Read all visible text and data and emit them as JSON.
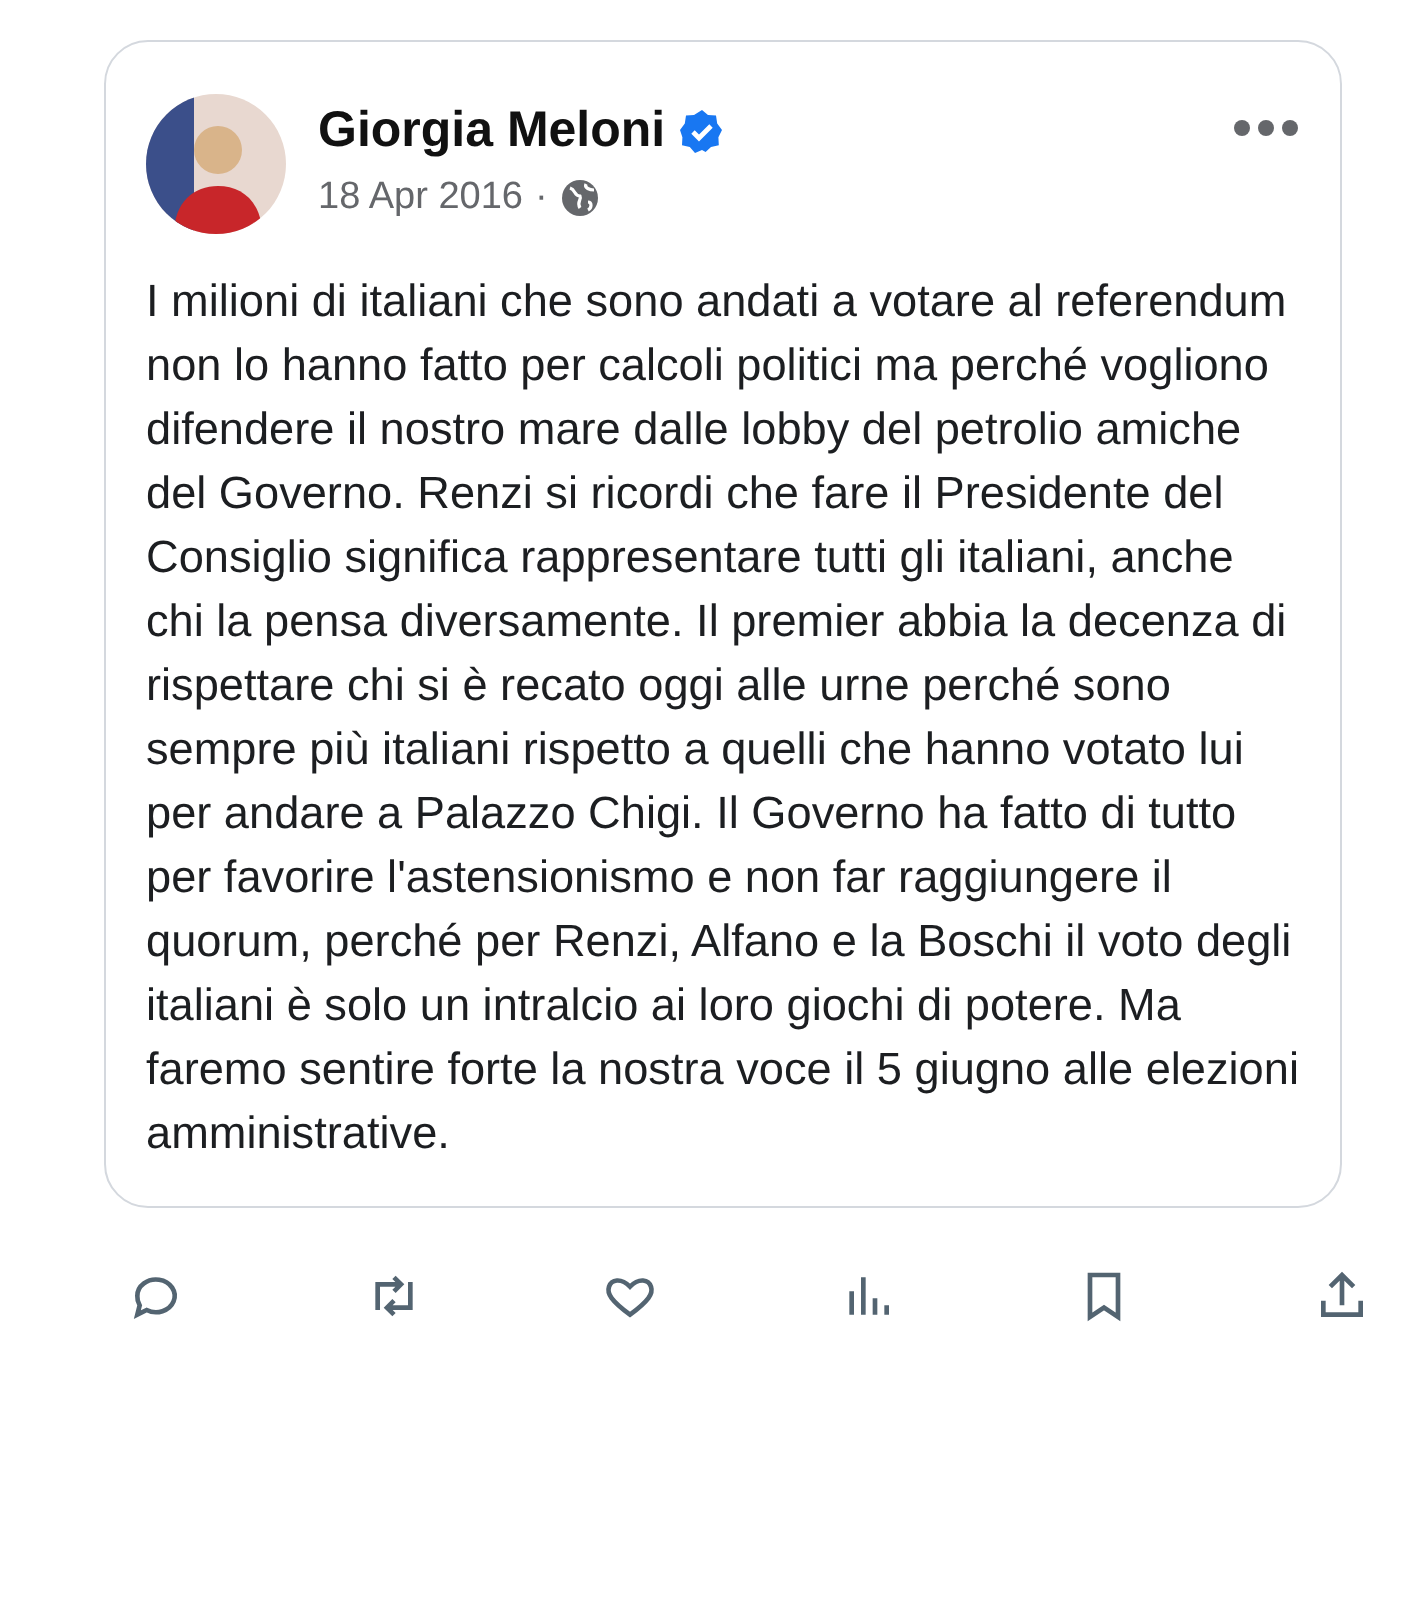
{
  "post": {
    "author": "Giorgia Meloni",
    "verified": true,
    "date": "18 Apr 2016",
    "separator": "·",
    "text": "I milioni di italiani che sono andati a votare al referendum non lo hanno fatto per calcoli politici ma perché vogliono difendere il nostro mare dalle lobby del petrolio amiche del Governo. Renzi si ricordi che fare il Presidente del Consiglio significa rappresentare tutti gli italiani, anche chi la pensa diversamente. Il premier abbia la decenza di rispettare chi si è recato oggi alle urne perché sono sempre più italiani rispetto a quelli che hanno votato lui per andare a Palazzo Chigi. Il Governo ha fatto di tutto per favorire l'astensionismo e non far raggiungere il quorum, perché per Renzi, Alfano e la Boschi il voto degli italiani è solo un intralcio ai loro giochi di potere. Ma faremo sentire forte la nostra voce il 5 giugno alle elezioni amministrative."
  },
  "actions": [
    {
      "kind": "reply"
    },
    {
      "kind": "repost"
    },
    {
      "kind": "like"
    },
    {
      "kind": "views"
    },
    {
      "kind": "bookmark"
    },
    {
      "kind": "share"
    }
  ]
}
